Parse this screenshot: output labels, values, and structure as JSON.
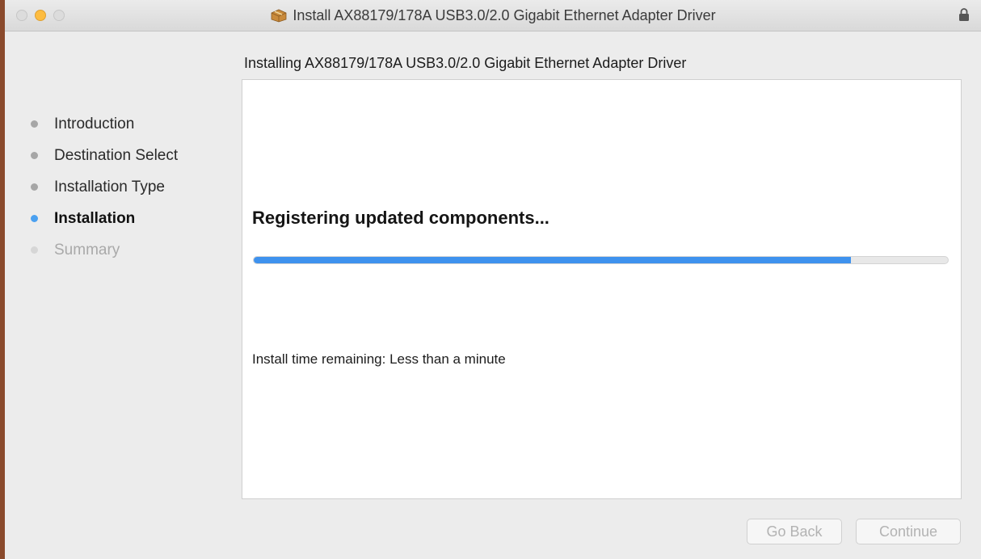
{
  "window": {
    "title": "Install AX88179/178A USB3.0/2.0 Gigabit Ethernet Adapter Driver",
    "title_icon": "package-icon",
    "lock_icon": "lock-icon"
  },
  "header": {
    "subtitle": "Installing AX88179/178A USB3.0/2.0 Gigabit Ethernet Adapter Driver"
  },
  "sidebar": {
    "steps": [
      {
        "label": "Introduction",
        "state": "done"
      },
      {
        "label": "Destination Select",
        "state": "done"
      },
      {
        "label": "Installation Type",
        "state": "done"
      },
      {
        "label": "Installation",
        "state": "current"
      },
      {
        "label": "Summary",
        "state": "pending"
      }
    ]
  },
  "main": {
    "status": "Registering updated components...",
    "progress_percent": 86,
    "time_remaining": "Install time remaining: Less than a minute"
  },
  "footer": {
    "back_label": "Go Back",
    "continue_label": "Continue"
  },
  "colors": {
    "accent": "#3e92ee",
    "current_step_dot": "#4aa0f0",
    "minimize_button": "#fdbc40"
  }
}
